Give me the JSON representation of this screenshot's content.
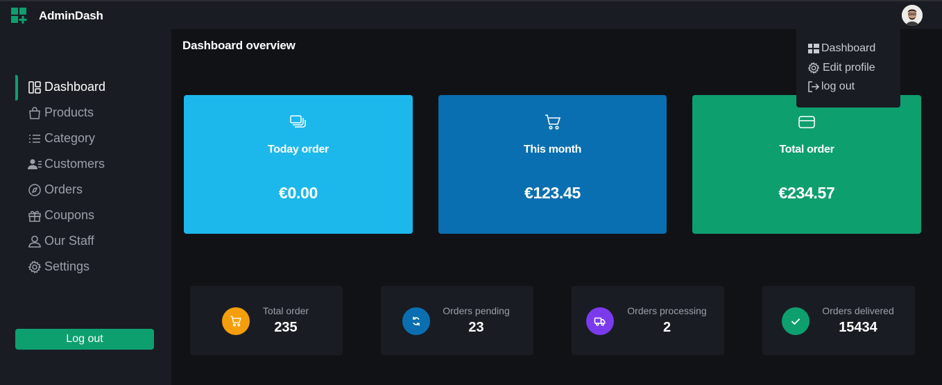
{
  "app": {
    "title": "AdminDash"
  },
  "colors": {
    "accent": "#0e9f6e",
    "card_today": "#1cb8ec",
    "card_month": "#0a6fb0",
    "card_total": "#0e9f6e",
    "stat_orange": "#f59e0b",
    "stat_blue": "#0a6fb0",
    "stat_purple": "#7c3aed",
    "stat_green": "#0e9f6e"
  },
  "sidebar": {
    "items": [
      {
        "label": "Dashboard",
        "icon": "dashboard-icon"
      },
      {
        "label": "Products",
        "icon": "bag-icon"
      },
      {
        "label": "Category",
        "icon": "list-icon"
      },
      {
        "label": "Customers",
        "icon": "users-icon"
      },
      {
        "label": "Orders",
        "icon": "compass-icon"
      },
      {
        "label": "Coupons",
        "icon": "gift-icon"
      },
      {
        "label": "Our Staff",
        "icon": "user-icon"
      },
      {
        "label": "Settings",
        "icon": "gear-icon"
      }
    ],
    "logout_label": "Log out"
  },
  "main": {
    "title": "Dashboard overview"
  },
  "cards": [
    {
      "label": "Today order",
      "value": "€0.00",
      "icon": "layers-icon"
    },
    {
      "label": "This month",
      "value": "€123.45",
      "icon": "cart-icon"
    },
    {
      "label": "Total order",
      "value": "€234.57",
      "icon": "credit-card-icon"
    }
  ],
  "stats": [
    {
      "label": "Total order",
      "value": "235",
      "icon": "cart-icon"
    },
    {
      "label": "Orders pending",
      "value": "23",
      "icon": "refresh-icon"
    },
    {
      "label": "Orders processing",
      "value": "2",
      "icon": "truck-icon"
    },
    {
      "label": "Orders delivered",
      "value": "15434",
      "icon": "check-icon"
    }
  ],
  "dropdown": {
    "items": [
      {
        "label": "Dashboard",
        "icon": "grid-icon"
      },
      {
        "label": "Edit profile",
        "icon": "gear-icon"
      },
      {
        "label": "log out",
        "icon": "logout-icon"
      }
    ]
  }
}
